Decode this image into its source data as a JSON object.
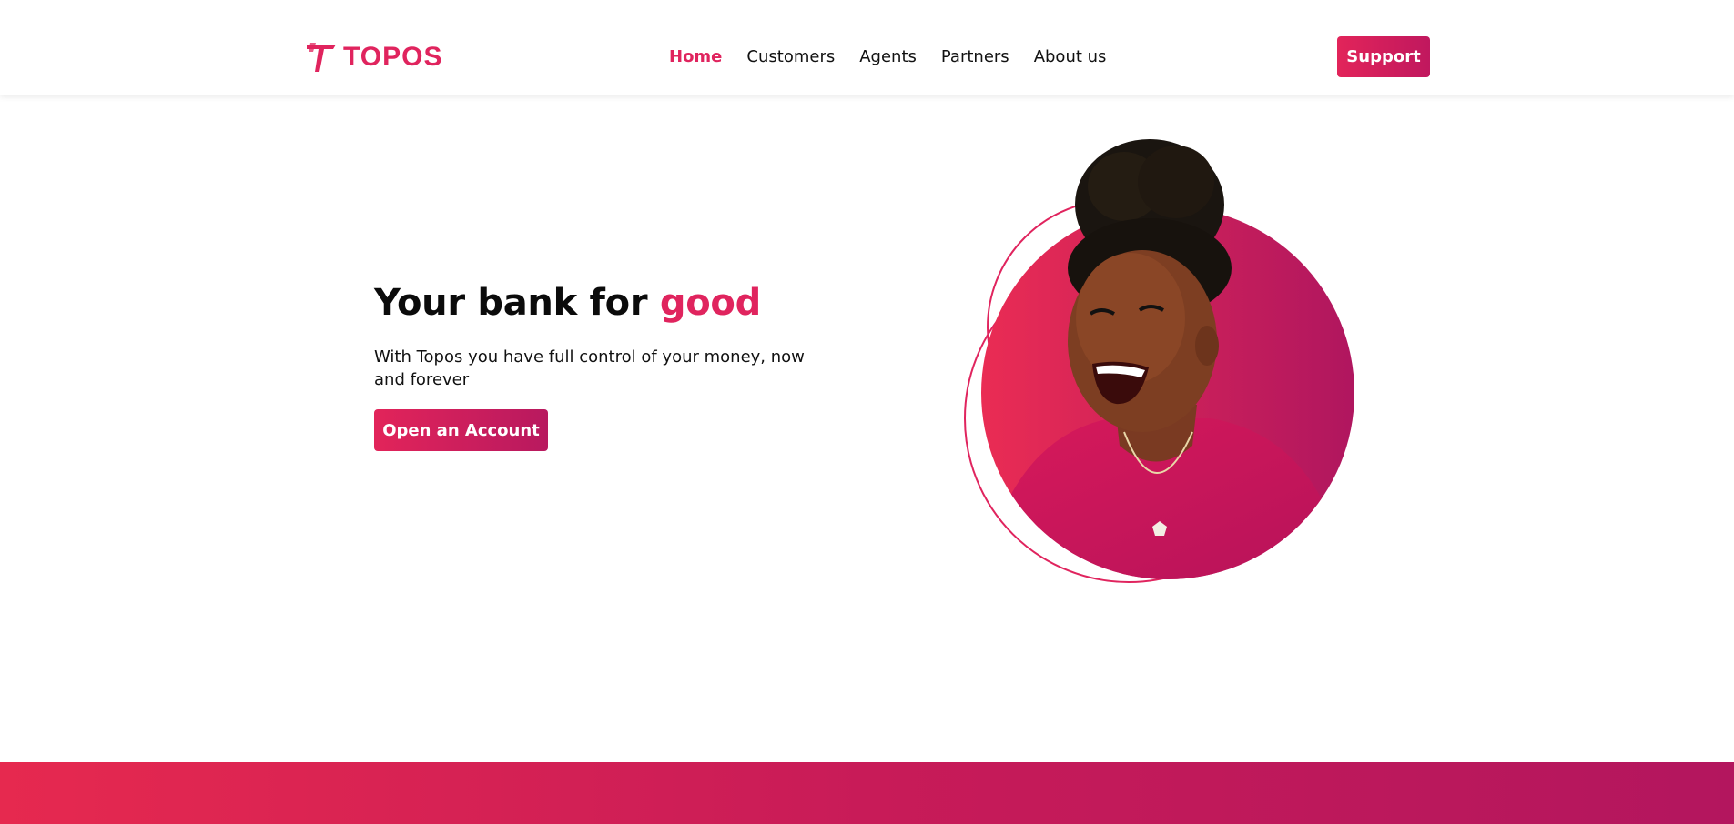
{
  "header": {
    "logo_text": "TOPOS",
    "nav": [
      {
        "label": "Home",
        "active": true
      },
      {
        "label": "Customers",
        "active": false
      },
      {
        "label": "Agents",
        "active": false
      },
      {
        "label": "Partners",
        "active": false
      },
      {
        "label": "About us",
        "active": false
      }
    ],
    "support_label": "Support"
  },
  "hero": {
    "title_lead": "Your bank for ",
    "title_accent": "good",
    "subtitle": "With Topos you have full control of your money, now and forever",
    "cta_label": "Open an Account"
  },
  "colors": {
    "brand": "#e0245e",
    "brand_dark": "#b8195f",
    "text": "#111111",
    "background": "#ffffff"
  },
  "icons": {
    "logo": "topos-logo-icon"
  }
}
